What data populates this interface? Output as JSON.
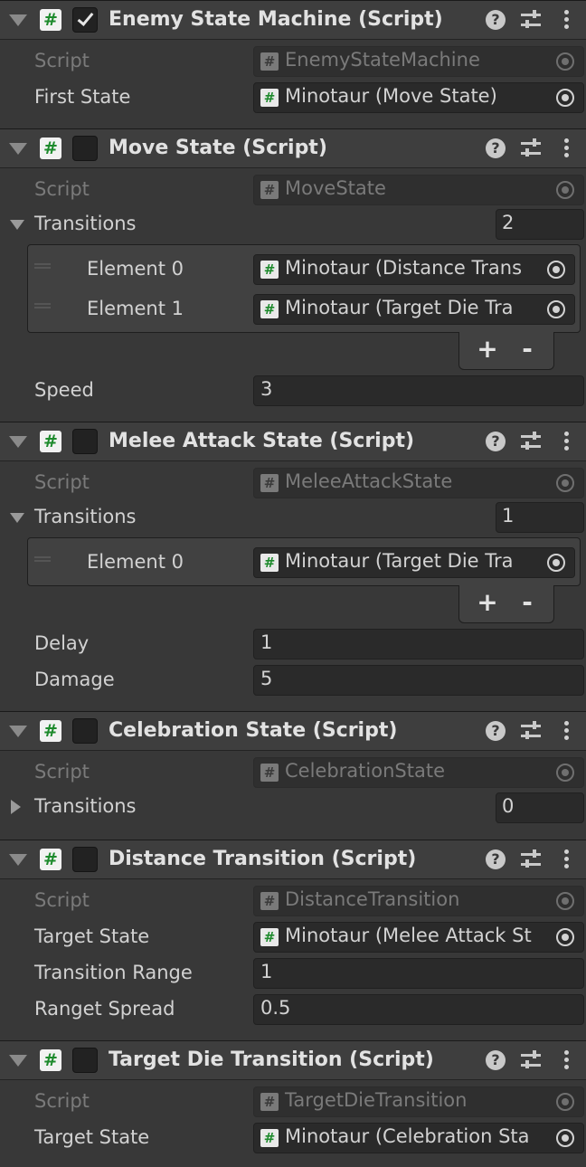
{
  "components": [
    {
      "title": "Enemy State Machine (Script)",
      "enabled": true,
      "script_label": "Script",
      "script_value": "EnemyStateMachine",
      "first_state_label": "First State",
      "first_state_value": "Minotaur (Move State)"
    },
    {
      "title": "Move State (Script)",
      "enabled": false,
      "script_label": "Script",
      "script_value": "MoveState",
      "transitions_label": "Transitions",
      "transitions_count": "2",
      "elements": [
        {
          "label": "Element 0",
          "value": "Minotaur (Distance Trans"
        },
        {
          "label": "Element 1",
          "value": "Minotaur (Target Die Tra"
        }
      ],
      "speed_label": "Speed",
      "speed_value": "3"
    },
    {
      "title": "Melee Attack State (Script)",
      "enabled": false,
      "script_label": "Script",
      "script_value": "MeleeAttackState",
      "transitions_label": "Transitions",
      "transitions_count": "1",
      "elements": [
        {
          "label": "Element 0",
          "value": "Minotaur (Target Die Tra"
        }
      ],
      "delay_label": "Delay",
      "delay_value": "1",
      "damage_label": "Damage",
      "damage_value": "5"
    },
    {
      "title": "Celebration State (Script)",
      "enabled": false,
      "script_label": "Script",
      "script_value": "CelebrationState",
      "transitions_label": "Transitions",
      "transitions_count": "0"
    },
    {
      "title": "Distance Transition (Script)",
      "enabled": false,
      "script_label": "Script",
      "script_value": "DistanceTransition",
      "target_state_label": "Target State",
      "target_state_value": "Minotaur (Melee Attack St",
      "range_label": "Transition Range",
      "range_value": "1",
      "spread_label": "Ranget Spread",
      "spread_value": "0.5"
    },
    {
      "title": "Target Die Transition (Script)",
      "enabled": false,
      "script_label": "Script",
      "script_value": "TargetDieTransition",
      "target_state_label": "Target State",
      "target_state_value": "Minotaur (Celebration Sta"
    }
  ],
  "glyphs": {
    "script_icon": "#",
    "help": "?",
    "add": "+",
    "remove": "-"
  },
  "icons": [
    "foldout-arrow-icon",
    "csharp-script-icon",
    "help-icon",
    "presets-icon",
    "menu-icon",
    "object-picker-icon",
    "drag-handle-icon"
  ]
}
